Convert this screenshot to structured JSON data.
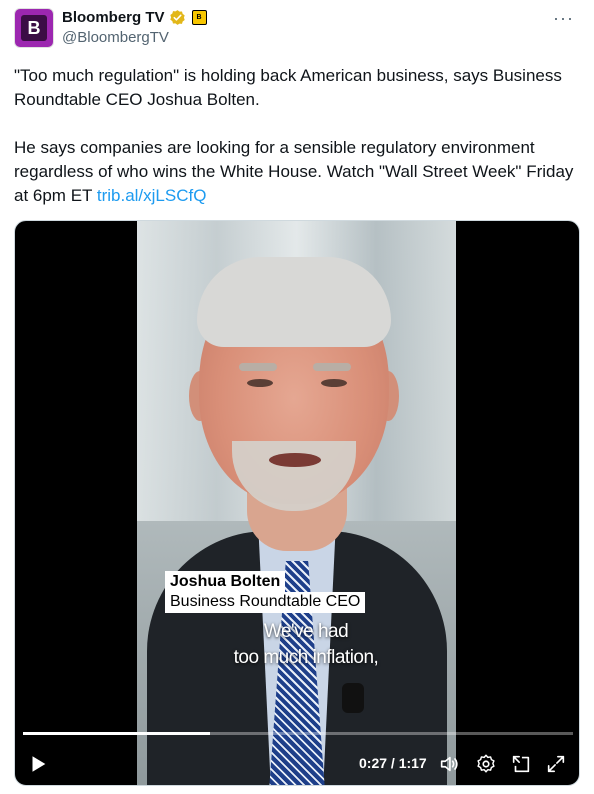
{
  "account": {
    "display_name": "Bloomberg TV",
    "handle": "@BloombergTV",
    "avatar_letter": "B",
    "affiliate_badge_letter": "B"
  },
  "tweet": {
    "paragraph1": "\"Too much regulation\" is holding back American business, says Business Roundtable CEO Joshua Bolten.",
    "paragraph2": "He says companies are looking for a sensible regulatory environment regardless of who wins the White House. Watch \"Wall Street Week\" Friday at 6pm ET",
    "link_text": "trib.al/xjLSCfQ"
  },
  "video": {
    "lower_third_name": "Joshua Bolten",
    "lower_third_title": "Business Roundtable CEO",
    "caption_line1": "We've had",
    "caption_line2": "too much inflation,",
    "time_display": "0:27 / 1:17",
    "progress_fraction": 0.34
  },
  "icons": {
    "more": "more-options-icon",
    "verified": "verified-badge-icon",
    "play": "play-icon",
    "volume": "volume-icon",
    "settings": "gear-icon",
    "pip": "picture-in-picture-icon",
    "fullscreen": "fullscreen-icon"
  },
  "colors": {
    "link": "#1d9bf0",
    "verified": "#e2b719",
    "avatar_bg": "#9c27b0"
  }
}
